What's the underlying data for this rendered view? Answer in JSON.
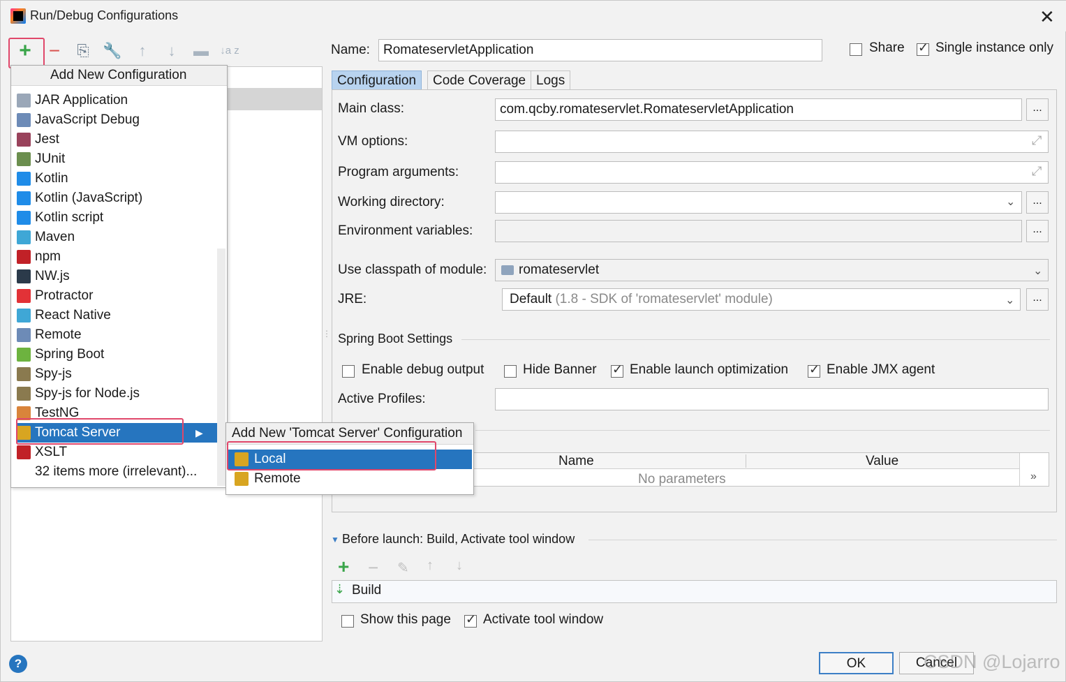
{
  "window": {
    "title": "Run/Debug Configurations",
    "close": "✕"
  },
  "toolbar": {
    "add": "+",
    "remove": "−",
    "copy": "⎘",
    "edit_defaults": "🔧",
    "move_up": "↑",
    "move_down": "↓",
    "folder": "▬",
    "sort": "↓a z"
  },
  "popup": {
    "header": "Add New Configuration",
    "items": [
      {
        "label": "JAR Application",
        "color": "#9aa7b8"
      },
      {
        "label": "JavaScript Debug",
        "color": "#6d8bb7"
      },
      {
        "label": "Jest",
        "color": "#99425b"
      },
      {
        "label": "JUnit",
        "color": "#6b8e4e"
      },
      {
        "label": "Kotlin",
        "color": "#1f8ce8"
      },
      {
        "label": "Kotlin (JavaScript)",
        "color": "#1f8ce8"
      },
      {
        "label": "Kotlin script",
        "color": "#1f8ce8"
      },
      {
        "label": "Maven",
        "color": "#3fa7d6"
      },
      {
        "label": "npm",
        "color": "#c12127"
      },
      {
        "label": "NW.js",
        "color": "#2b3a4a"
      },
      {
        "label": "Protractor",
        "color": "#e23237"
      },
      {
        "label": "React Native",
        "color": "#3fa7d6"
      },
      {
        "label": "Remote",
        "color": "#6d8bb7"
      },
      {
        "label": "Spring Boot",
        "color": "#6db33f"
      },
      {
        "label": "Spy-js",
        "color": "#8a7a4f"
      },
      {
        "label": "Spy-js for Node.js",
        "color": "#8a7a4f"
      },
      {
        "label": "TestNG",
        "color": "#d9843b"
      },
      {
        "label": "Tomcat Server",
        "color": "#d8a521"
      },
      {
        "label": "XSLT",
        "color": "#c12127"
      },
      {
        "label": "32 items more (irrelevant)...",
        "color": ""
      }
    ],
    "submenu_arrow": "▶"
  },
  "submenu": {
    "header": "Add New 'Tomcat Server' Configuration",
    "items": [
      {
        "label": "Local"
      },
      {
        "label": "Remote"
      }
    ]
  },
  "form": {
    "name_label": "Name:",
    "name_value": "RomateservletApplication",
    "share_label": "Share",
    "single_instance_label": "Single instance only",
    "tabs": [
      "Configuration",
      "Code Coverage",
      "Logs"
    ],
    "main_class_label": "Main class:",
    "main_class_value": "com.qcby.romateservlet.RomateservletApplication",
    "vm_options_label": "VM options:",
    "program_args_label": "Program arguments:",
    "working_dir_label": "Working directory:",
    "env_vars_label": "Environment variables:",
    "classpath_label": "Use classpath of module:",
    "classpath_value": "romateservlet",
    "jre_label": "JRE:",
    "jre_value": "Default",
    "jre_hint": "(1.8 - SDK of 'romateservlet' module)",
    "spring_section": "Spring Boot Settings",
    "enable_debug_label": "Enable debug output",
    "hide_banner_label": "Hide Banner",
    "launch_opt_label": "Enable launch optimization",
    "jmx_label": "Enable JMX agent",
    "active_profiles_label": "Active Profiles:",
    "params_name_header": "Name",
    "params_value_header": "Value",
    "params_empty": "No parameters",
    "expand_params": "»",
    "browse": "..."
  },
  "before_launch": {
    "title": "Before launch: Build, Activate tool window",
    "build_item": "Build",
    "show_page_label": "Show this page",
    "activate_window_label": "Activate tool window"
  },
  "footer": {
    "ok": "OK",
    "cancel": "Cancel",
    "help": "?",
    "watermark": "CSDN @Lojarro"
  }
}
